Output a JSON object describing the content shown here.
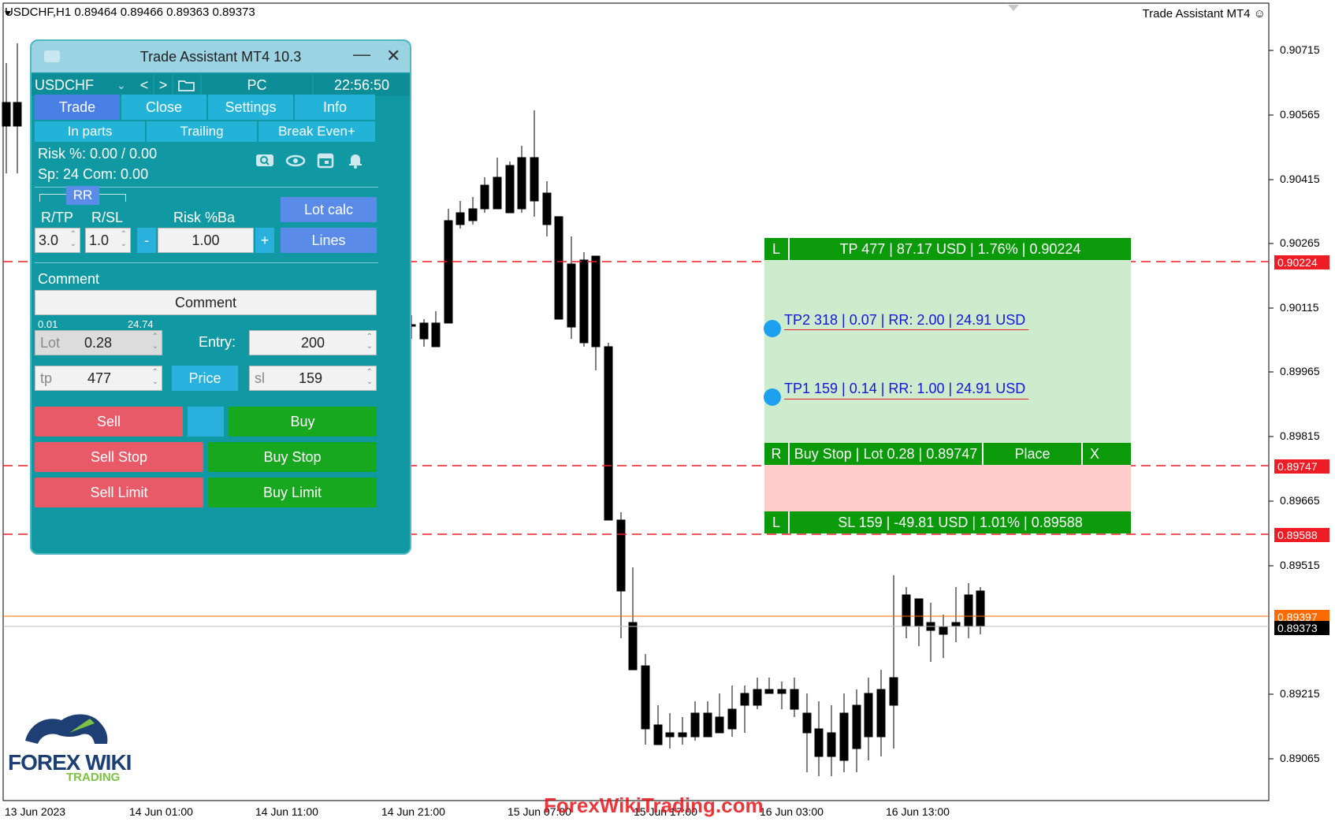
{
  "header": {
    "symbol_info": "USDCHF,H1  0.89464 0.89466 0.89363 0.89373",
    "ea_name": "Trade Assistant MT4 ☺"
  },
  "price_axis": {
    "ticks": [
      "0.90715",
      "0.90565",
      "0.90415",
      "0.90265",
      "0.90115",
      "0.89965",
      "0.89815",
      "0.89665",
      "0.89515",
      "0.89215",
      "0.89065"
    ],
    "tp_tag": "0.90224",
    "entry_tag": "0.89747",
    "sl_tag": "0.89588",
    "ask_tag": "0.89397",
    "bid_tag": "0.89373",
    "colors": {
      "red": "#ee1c25",
      "ask": "#ff6a00",
      "bid": "#000000"
    }
  },
  "time_axis": {
    "labels": [
      "13 Jun 2023",
      "14 Jun 01:00",
      "14 Jun 11:00",
      "14 Jun 21:00",
      "15 Jun 07:00",
      "15 Jun 17:00",
      "16 Jun 03:00",
      "16 Jun 13:00"
    ]
  },
  "panel": {
    "title": "Trade Assistant MT4 10.3",
    "symbol": "USDCHF",
    "prev": "<",
    "next": ">",
    "account": "PC",
    "clock": "22:56:50",
    "tabs": [
      "Trade",
      "Close",
      "Settings",
      "Info"
    ],
    "subtabs": [
      "In parts",
      "Trailing",
      "Break Even+"
    ],
    "risk_line": "Risk %: 0.00 /  0.00",
    "sp_line": "Sp: 24  Com: 0.00",
    "rr_label": "RR",
    "rtp_label": "R/TP",
    "rsl_label": "R/SL",
    "risk_ba_label": "Risk %Ba",
    "rtp_value": "3.0",
    "rsl_value": "1.0",
    "minus": "-",
    "plus": "+",
    "risk_value": "1.00",
    "lot_calc": "Lot calc",
    "lines": "Lines",
    "comment_label": "Comment",
    "comment_value": "Comment",
    "lot_min": "0.01",
    "lot_max": "24.74",
    "lot_label": "Lot",
    "lot_value": "0.28",
    "entry_label": "Entry:",
    "entry_value": "200",
    "tp_label": "tp",
    "tp_value": "477",
    "price_btn": "Price",
    "sl_label": "sl",
    "sl_value": "159",
    "sell": "Sell",
    "buy": "Buy",
    "sell_stop": "Sell Stop",
    "buy_stop": "Buy Stop",
    "sell_limit": "Sell Limit",
    "buy_limit": "Buy Limit"
  },
  "overlay": {
    "tp_tag": "L",
    "tp_text": "TP 477 | 87.17 USD | 1.76% | 0.90224",
    "tp2_text": "TP2 318 | 0.07 | RR: 2.00 | 24.91 USD",
    "tp1_text": "TP1 159 | 0.14 | RR: 1.00 | 24.91 USD",
    "order_tag": "R",
    "order_text": "Buy Stop | Lot 0.28 | 0.89747",
    "place": "Place",
    "close_x": "X",
    "sl_tag": "L",
    "sl_text": "SL 159 | -49.81 USD | 1.01% | 0.89588"
  },
  "watermark": {
    "logo_main": "FOREX WIKI",
    "logo_sub": "TRADING",
    "site": "ForexWikiTrading.com"
  }
}
